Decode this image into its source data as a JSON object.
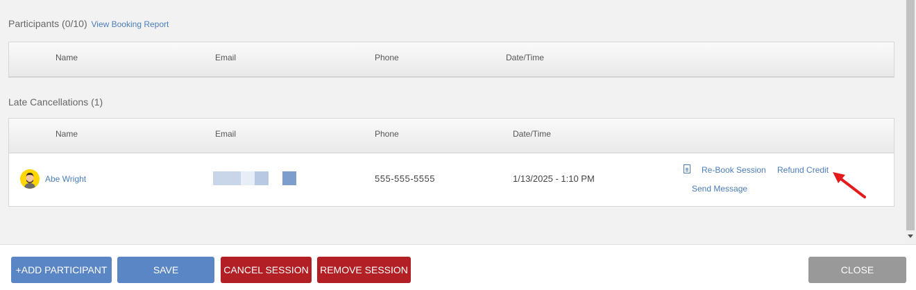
{
  "participants": {
    "heading": "Participants (0/10)",
    "report_link": "View Booking Report",
    "columns": [
      "Name",
      "Email",
      "Phone",
      "Date/Time"
    ]
  },
  "late_cancellations": {
    "heading": "Late Cancellations (1)",
    "columns": [
      "Name",
      "Email",
      "Phone",
      "Date/Time"
    ],
    "rows": [
      {
        "name": "Abe Wright",
        "phone": "555-555-5555",
        "datetime": "1/13/2025 - 1:10 PM",
        "actions": {
          "rebook": "Re-Book Session",
          "refund": "Refund Credit",
          "message": "Send Message"
        }
      }
    ]
  },
  "footer": {
    "add_participant": "+ADD PARTICIPANT",
    "save": "SAVE",
    "cancel_session": "CANCEL SESSION",
    "remove_session": "REMOVE SESSION",
    "close": "CLOSE"
  },
  "colors": {
    "link": "#4a7db8",
    "primary_button": "#5b86c5",
    "danger_button": "#b21f24",
    "close_button": "#999999",
    "annotation_arrow": "#e31b1b",
    "avatar_bg": "#ffd600"
  },
  "icons": [
    "document-icon",
    "avatar-icon",
    "arrow-annotation-icon",
    "scroll-down-icon"
  ]
}
